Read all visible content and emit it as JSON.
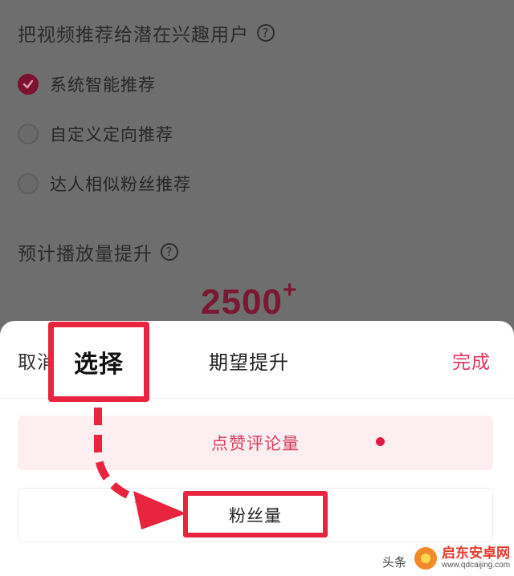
{
  "background": {
    "recommend_title": "把视频推荐给潜在兴趣用户",
    "options": [
      {
        "label": "系统智能推荐",
        "checked": true
      },
      {
        "label": "自定义定向推荐",
        "checked": false
      },
      {
        "label": "达人相似粉丝推荐",
        "checked": false
      }
    ],
    "estimate_title": "预计播放量提升",
    "estimate_value": "2500",
    "estimate_suffix": "+"
  },
  "sheet": {
    "cancel_label": "取消",
    "title": "期望提升",
    "done_label": "完成",
    "options": [
      {
        "label": "点赞评论量",
        "selected": true
      },
      {
        "label": "粉丝量",
        "selected": false
      }
    ]
  },
  "annotation": {
    "label": "选择",
    "color": "#e8243f"
  },
  "watermark": {
    "source": "头条",
    "site_name": "启东安卓网",
    "site_url": "www.qdcaijing.com"
  },
  "colors": {
    "accent": "#e5325a",
    "selected_bg": "#fdeef1"
  }
}
